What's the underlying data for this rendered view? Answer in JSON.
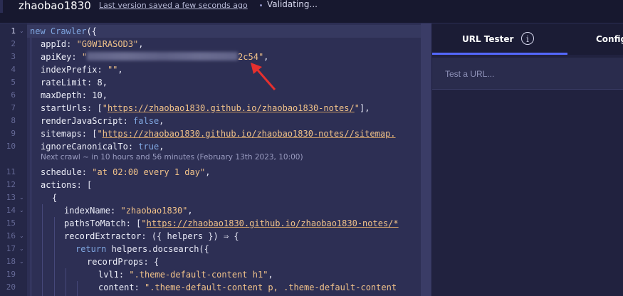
{
  "header": {
    "title": "zhaobao1830",
    "saved_link": "Last version saved a few seconds ago",
    "status": "Validating..."
  },
  "editor": {
    "line_numbers": [
      "1",
      "2",
      "3",
      "4",
      "5",
      "6",
      "7",
      "8",
      "9",
      "10",
      "",
      "11",
      "12",
      "13",
      "14",
      "15",
      "16",
      "17",
      "18",
      "19",
      "20"
    ],
    "hint": "Next crawl ~ in 10 hours and 56 minutes (February 13th 2023, 10:00)",
    "code": {
      "l1_k": "new",
      "l1_b": "Crawler",
      "l1_p": "({",
      "l2_k": "appId",
      "l2_v": "\"G0W1RASOD3\"",
      "l3_k": "apiKey",
      "l3_v1": "\"",
      "l3_v2": "2c54\"",
      "l4_k": "indexPrefix",
      "l4_v": "\"\"",
      "l5_k": "rateLimit",
      "l5_v": "8",
      "l6_k": "maxDepth",
      "l6_v": "10",
      "l7_k": "startUrls",
      "l7_v": "https://zhaobao1830.github.io/zhaobao1830-notes/",
      "l8_k": "renderJavaScript",
      "l8_v": "false",
      "l9_k": "sitemaps",
      "l9_v": "https://zhaobao1830.github.io/zhaobao1830-notes//sitemap.",
      "l10_k": "ignoreCanonicalTo",
      "l10_v": "true",
      "l11_k": "schedule",
      "l11_v": "\"at 02:00 every 1 day\"",
      "l12_k": "actions",
      "l12_v": "[",
      "l13_v": "{",
      "l14_k": "indexName",
      "l14_v": "\"zhaobao1830\"",
      "l15_k": "pathsToMatch",
      "l15_v": "https://zhaobao1830.github.io/zhaobao1830-notes/*",
      "l16_k": "recordExtractor",
      "l16_v": "({ helpers }) ⇒ {",
      "l17_r": "return",
      "l17_v": "helpers.docsearch({",
      "l18_k": "recordProps",
      "l18_v": "{",
      "l19_k": "lvl1",
      "l19_v": "\".theme-default-content h1\"",
      "l20_k": "content",
      "l20_v": "\".theme-default-content p, .theme-default-content"
    }
  },
  "panel": {
    "tab_url_tester": "URL Tester",
    "tab_config": "Config",
    "url_placeholder": "Test a URL..."
  },
  "colors": {
    "accent": "#5468ff",
    "arrow": "#e5302e"
  },
  "icons": [
    "info-icon",
    "arrow-annotation"
  ]
}
